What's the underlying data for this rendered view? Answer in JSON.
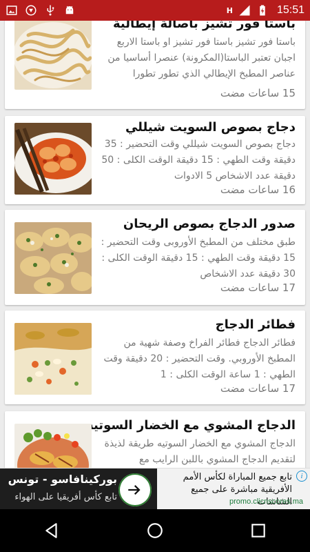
{
  "status_bar": {
    "time": "15:51",
    "network_label": "H",
    "icons": [
      "image-icon",
      "shield-icon",
      "usb-icon",
      "android-icon",
      "signal-icon",
      "battery-charging-icon"
    ]
  },
  "recipes": [
    {
      "title": "باستا فور تشيز باصالة إيطالية",
      "description": "باستا فور تشيز باستا فور تشيز او باستا الاربع اجبان تعتبر الباستا(المكرونة) عنصرا أساسيا من عناصر المطبخ الإيطالي الذي تطور تطورا",
      "time": "15 ساعات مضت",
      "image": "pasta-photo"
    },
    {
      "title": "دجاج بصوص السويت شيللي",
      "description": "دجاج بصوص السويت شيللي وقت التحضير : 35 دقيقة وقت الطهي : 15 دقيقة الوقت الكلى : 50 دقيقة عدد الاشخاص 5 الادوات",
      "time": "16 ساعات مضت",
      "image": "sweet-chili-chicken-photo"
    },
    {
      "title": "صدور الدجاج بصوص الريحان",
      "description": "طبق مختلف من المطبخ الأوروبى وقت التحضير : 15 دقيقة وقت الطهي : 15 دقيقة الوقت الكلى : 30 دقيقة عدد الاشخاص",
      "time": "17 ساعات مضت",
      "image": "basil-chicken-photo"
    },
    {
      "title": "فطائر الدجاج",
      "description": "فطائر الدجاج فطائر الفراخ وصفة شهية من المطبخ الأوروبي. وقت التحضير : 20 دقيقة وقت الطهي : 1 ساعة الوقت الكلى : 1",
      "time": "17 ساعات مضت",
      "image": "chicken-pie-photo"
    },
    {
      "title": "الدجاج المشوي مع الخضار السوتيه",
      "description": "الدجاج المشوي مع الخضار السوتيه طريقة لذيذة لتقديم الدجاج المشوي باللبن الرايب مع",
      "time": "",
      "image": "grilled-chicken-photo"
    }
  ],
  "ad": {
    "title": "بوركينافاسو - تونس",
    "subtitle": "تابع كأس أفريقيا على الهواء",
    "headline": "تابع جميع المباراة لكأس الأمم الأفريقية مباشرة على جميع الشاشات",
    "url": "promo.clicnscores.ma",
    "info_label": "i"
  },
  "nav": {
    "buttons": [
      "back-button",
      "home-button",
      "recents-button"
    ]
  }
}
